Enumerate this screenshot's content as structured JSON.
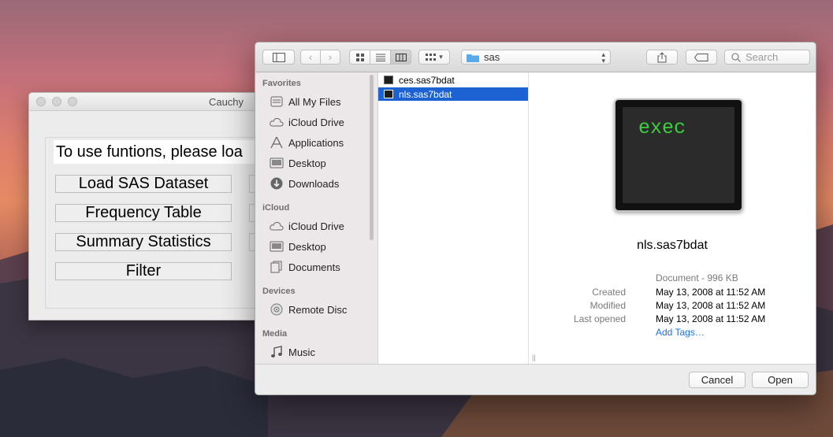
{
  "cauchy": {
    "title": "Cauchy",
    "message": "To use funtions, please loa",
    "buttons": [
      "Load SAS Dataset",
      "Frequency Table",
      "Summary Statistics",
      "Filter"
    ]
  },
  "dialog": {
    "path": "sas",
    "search_placeholder": "Search",
    "sidebar": {
      "sections": [
        {
          "title": "Favorites",
          "items": [
            {
              "label": "All My Files",
              "icon": "all-files-icon"
            },
            {
              "label": "iCloud Drive",
              "icon": "cloud-icon"
            },
            {
              "label": "Applications",
              "icon": "applications-icon"
            },
            {
              "label": "Desktop",
              "icon": "desktop-icon"
            },
            {
              "label": "Downloads",
              "icon": "downloads-icon"
            }
          ]
        },
        {
          "title": "iCloud",
          "items": [
            {
              "label": "iCloud Drive",
              "icon": "cloud-icon"
            },
            {
              "label": "Desktop",
              "icon": "desktop-icon"
            },
            {
              "label": "Documents",
              "icon": "documents-icon"
            }
          ]
        },
        {
          "title": "Devices",
          "items": [
            {
              "label": "Remote Disc",
              "icon": "disc-icon"
            }
          ]
        },
        {
          "title": "Media",
          "items": [
            {
              "label": "Music",
              "icon": "music-icon"
            }
          ]
        }
      ]
    },
    "files": [
      {
        "name": "ces.sas7bdat",
        "selected": false
      },
      {
        "name": "nls.sas7bdat",
        "selected": true
      }
    ],
    "preview": {
      "icon_text": "exec",
      "name": "nls.sas7bdat",
      "kind": "Document - 996 KB",
      "created_label": "Created",
      "created": "May 13, 2008 at 11:52 AM",
      "modified_label": "Modified",
      "modified": "May 13, 2008 at 11:52 AM",
      "last_opened_label": "Last opened",
      "last_opened": "May 13, 2008 at 11:52 AM",
      "add_tags": "Add Tags…"
    },
    "cancel_label": "Cancel",
    "open_label": "Open"
  },
  "colors": {
    "accent": "#1d62d2",
    "exec_green": "#3bd03b",
    "link": "#1b6fe0"
  }
}
